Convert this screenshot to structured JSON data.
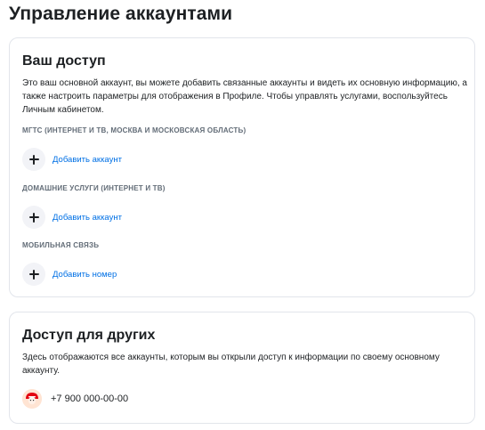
{
  "page": {
    "title": "Управление аккаунтами"
  },
  "your_access": {
    "title": "Ваш доступ",
    "description": "Это ваш основной аккаунт, вы можете добавить связанные аккаунты и видеть их основную информацию, а также настроить параметры для отображения в Профиле. Чтобы управлять услугами, воспользуйтесь Личным кабинетом.",
    "sections": [
      {
        "label": "МГТС (ИНТЕРНЕТ И ТВ, МОСКВА И МОСКОВСКАЯ ОБЛАСТЬ)",
        "action": "Добавить аккаунт",
        "icon": "plus-icon"
      },
      {
        "label": "ДОМАШНИЕ УСЛУГИ (ИНТЕРНЕТ И ТВ)",
        "action": "Добавить аккаунт",
        "icon": "plus-icon"
      },
      {
        "label": "МОБИЛЬНАЯ СВЯЗЬ",
        "action": "Добавить номер",
        "icon": "plus-icon"
      }
    ]
  },
  "others_access": {
    "title": "Доступ для других",
    "description": "Здесь отображаются все аккаунты, которым вы открыли доступ к информации по своему основному аккаунту.",
    "accounts": [
      {
        "phone": "+7 900 000-00-00",
        "avatar": "avatar-icon"
      }
    ]
  },
  "colors": {
    "link": "#0070e5",
    "section_label": "#626c77",
    "card_border": "#e2e5eb",
    "plus_bg": "#f2f3f7",
    "avatar_red": "#e30611"
  }
}
